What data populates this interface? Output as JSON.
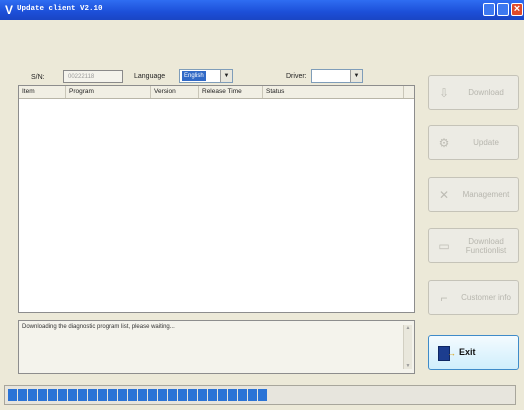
{
  "window": {
    "title": "Update client V2.10"
  },
  "form": {
    "sn_label": "S/N:",
    "sn_value": "00222118",
    "language_label": "Language",
    "language_value": "English",
    "driver_label": "Driver:",
    "driver_value": ""
  },
  "table": {
    "columns": [
      "Item",
      "Program",
      "Version",
      "Release Time",
      "Status"
    ],
    "rows": []
  },
  "log": {
    "message": "Downloading the diagnostic program list, please waiting..."
  },
  "sidebar": {
    "buttons": [
      {
        "label": "Download",
        "icon": "download-icon",
        "enabled": false
      },
      {
        "label": "Update",
        "icon": "update-gear-icon",
        "enabled": false
      },
      {
        "label": "Management",
        "icon": "management-tools-icon",
        "enabled": false
      },
      {
        "label": "Download Functionlist",
        "icon": "function-list-icon",
        "enabled": false
      },
      {
        "label": "Customer info",
        "icon": "customer-info-icon",
        "enabled": false
      },
      {
        "label": "Exit",
        "icon": "exit-door-icon",
        "enabled": true
      }
    ]
  },
  "progress": {
    "fraction": 0.61
  },
  "colors": {
    "titlebar": "#1c4fd8",
    "progress": "#2a73d6",
    "exit_border": "#3f8bc9"
  }
}
